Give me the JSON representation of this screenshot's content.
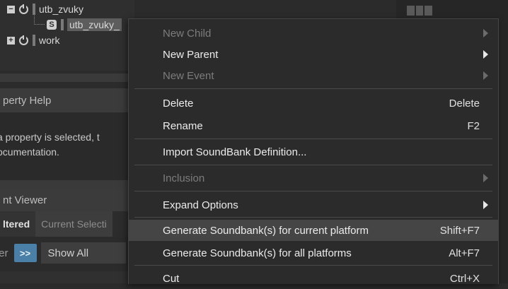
{
  "tree": {
    "items": [
      {
        "label": "utb_zvuky",
        "expander": "−",
        "icon": "work-unit-icon"
      },
      {
        "label": "utb_zvuky_",
        "icon": "soundbank-icon",
        "icon_glyph": "S"
      },
      {
        "label": "work",
        "expander": "+",
        "icon": "work-unit-icon"
      }
    ]
  },
  "property_help": {
    "title": "perty Help",
    "body_lines": [
      "a property is selected, t",
      "ocumentation."
    ]
  },
  "event_viewer": {
    "title": "nt Viewer",
    "tabs": [
      {
        "label": "ltered",
        "active": true
      },
      {
        "label": "Current Selecti",
        "active": false
      }
    ],
    "filter_label": "ter",
    "more_label": ">>",
    "show_all_label": "Show All"
  },
  "menu": {
    "items": [
      {
        "label": "New Child",
        "shortcut": "",
        "submenu": true,
        "disabled": true,
        "highlight": false
      },
      {
        "label": "New Parent",
        "shortcut": "",
        "submenu": true,
        "disabled": false,
        "highlight": false
      },
      {
        "label": "New Event",
        "shortcut": "",
        "submenu": true,
        "disabled": true,
        "highlight": false
      },
      {
        "label": "Delete",
        "shortcut": "Delete",
        "submenu": false,
        "disabled": false,
        "highlight": false
      },
      {
        "label": "Rename",
        "shortcut": "F2",
        "submenu": false,
        "disabled": false,
        "highlight": false
      },
      {
        "label": "Import SoundBank Definition...",
        "shortcut": "",
        "submenu": false,
        "disabled": false,
        "highlight": false
      },
      {
        "label": "Inclusion",
        "shortcut": "",
        "submenu": true,
        "disabled": true,
        "highlight": false
      },
      {
        "label": "Expand Options",
        "shortcut": "",
        "submenu": true,
        "disabled": false,
        "highlight": false
      },
      {
        "label": "Generate Soundbank(s) for current platform",
        "shortcut": "Shift+F7",
        "submenu": false,
        "disabled": false,
        "highlight": true
      },
      {
        "label": "Generate Soundbank(s) for all platforms",
        "shortcut": "Alt+F7",
        "submenu": false,
        "disabled": false,
        "highlight": false
      },
      {
        "label": "Cut",
        "shortcut": "Ctrl+X",
        "submenu": false,
        "disabled": false,
        "highlight": false
      }
    ]
  },
  "colors": {
    "menu_bg": "#2b2b2b",
    "highlight_bg": "#454545",
    "disabled_text": "#7c7c7c",
    "accent_button": "#4a7fa8"
  }
}
